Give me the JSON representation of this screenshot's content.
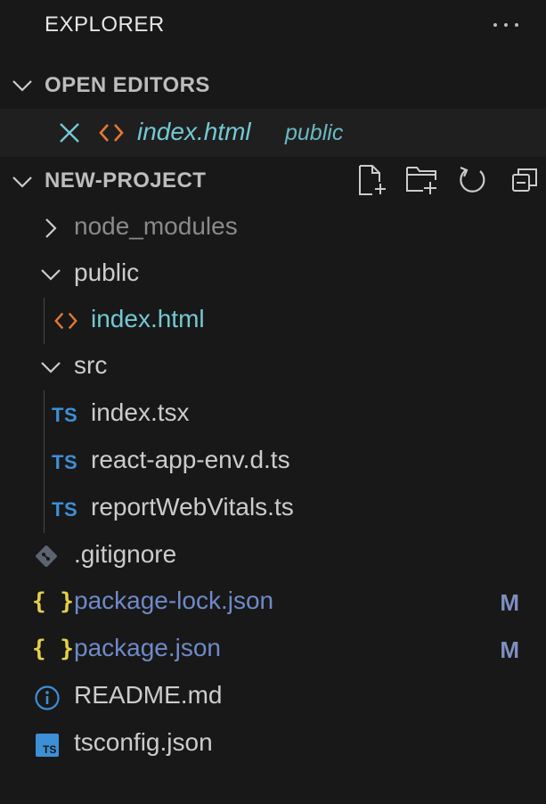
{
  "explorer": {
    "title": "EXPLORER"
  },
  "open_editors": {
    "title": "OPEN EDITORS",
    "file_name": "index.html",
    "file_dir": "public"
  },
  "project": {
    "title": "NEW-PROJECT",
    "tree": {
      "node_modules": "node_modules",
      "public": "public",
      "public_index": "index.html",
      "src": "src",
      "src_index": "index.tsx",
      "src_env": "react-app-env.d.ts",
      "src_vitals": "reportWebVitals.ts",
      "gitignore": ".gitignore",
      "package_lock": "package-lock.json",
      "package_lock_badge": "M",
      "package": "package.json",
      "package_badge": "M",
      "readme": "README.md",
      "tsconfig": "tsconfig.json"
    },
    "ts_icon_text": "TS",
    "braces_icon_text": "{ }"
  },
  "colors": {
    "background": "#181818",
    "html_icon": "#e37933",
    "html_label": "#73c9d3",
    "ts_icon": "#3d8fd6",
    "json_icon": "#e5d04a",
    "modified_label": "#6f89c8",
    "ignored_label": "#8a8a8a"
  }
}
